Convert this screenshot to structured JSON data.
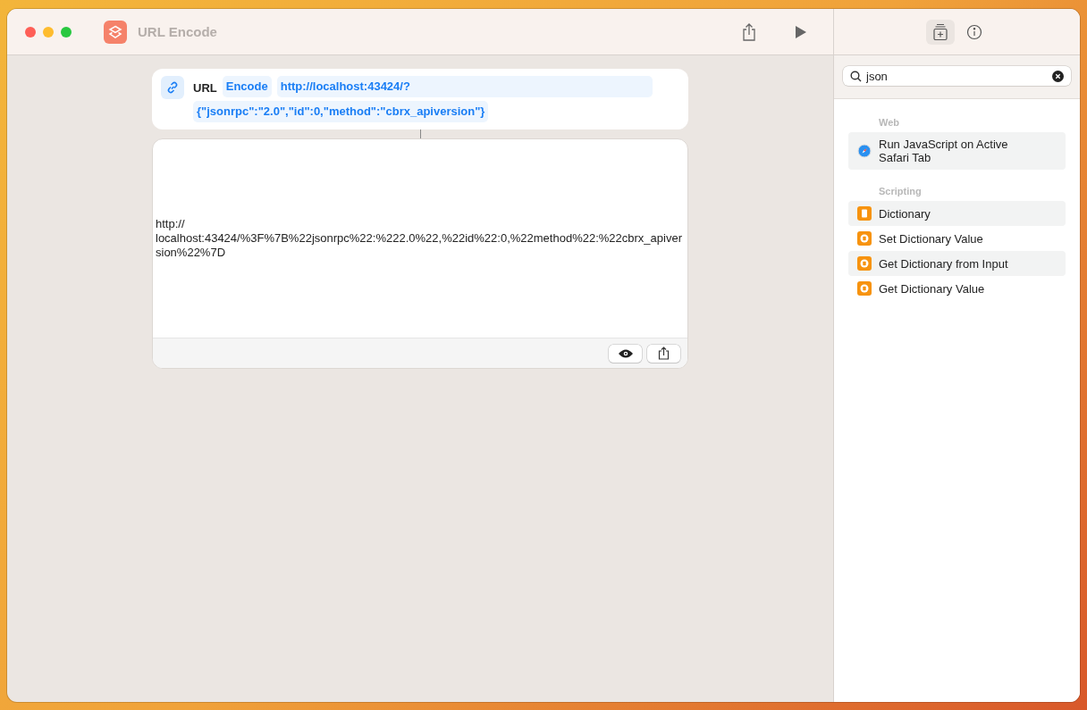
{
  "window": {
    "title": "URL Encode"
  },
  "action": {
    "label": "URL",
    "operation": "Encode",
    "url_lines": [
      "http://localhost:43424/?",
      "{\"jsonrpc\":\"2.0\",\"id\":0,\"method\":\"cbrx_apiversion\"}"
    ]
  },
  "result": {
    "text": "http://\nlocalhost:43424/%3F%7B%22jsonrpc%22:%222.0%22,%22id%22:0,%22method%22:%22cbrx_apiversion%22%7D"
  },
  "sidebar": {
    "search": {
      "value": "json"
    },
    "sections": [
      {
        "title": "Web",
        "items": [
          {
            "label": "Run JavaScript on Active Safari Tab",
            "kind": "safari"
          }
        ]
      },
      {
        "title": "Scripting",
        "items": [
          {
            "label": "Dictionary",
            "kind": "dictionary"
          },
          {
            "label": "Set Dictionary Value",
            "kind": "dictionary-action"
          },
          {
            "label": "Get Dictionary from Input",
            "kind": "dictionary-action"
          },
          {
            "label": "Get Dictionary Value",
            "kind": "dictionary-action"
          }
        ]
      }
    ]
  }
}
